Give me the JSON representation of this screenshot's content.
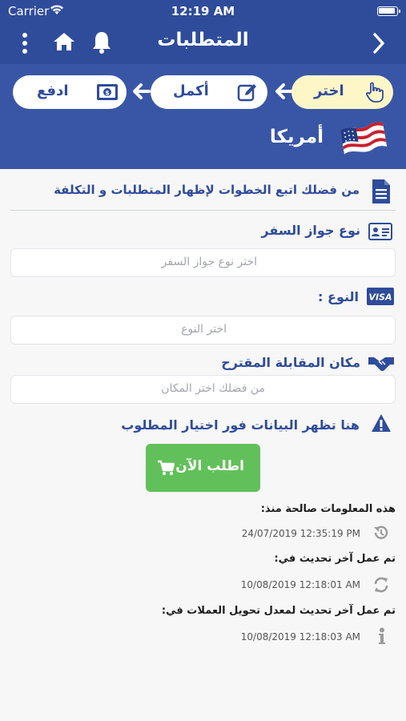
{
  "status": {
    "carrier": "Carrier",
    "time": "12:19 AM"
  },
  "nav": {
    "title": "المتطلبات"
  },
  "steps": [
    {
      "label": "اختر",
      "icon": "pointer-hand-icon",
      "active": true
    },
    {
      "label": "أكمل",
      "icon": "edit-pencil-icon",
      "active": false
    },
    {
      "label": "ادفع",
      "icon": "cash-icon",
      "active": false
    }
  ],
  "country": {
    "name": "أمريكا",
    "flag": "usa-flag-icon"
  },
  "info": "من فضلك اتبع الخطوات لإظهار المتطلبات و التكلفة",
  "fields": {
    "passport": {
      "label": "نوع جواز السفر",
      "placeholder": "اختر نوع جواز السفر"
    },
    "type": {
      "label": "النوع :",
      "placeholder": "اختر النوع"
    },
    "place": {
      "label": "مكان المقابلة المقترح",
      "placeholder": "من فضلك اختر المكان"
    }
  },
  "warning": "هنا تظهر البيانات فور اختيار المطلوب",
  "order_button": "اطلب الآن",
  "meta": {
    "valid_since_label": "هذه المعلومات صالحة منذ:",
    "valid_since_value": "24/07/2019 12:35:19 PM",
    "updated_label": "تم عمل آخر تحديث في:",
    "updated_value": "10/08/2019 12:18:01 AM",
    "currency_label": "تم عمل آخر تحديث لمعدل تحويل العملات في:",
    "currency_value": "10/08/2019 12:18:03 AM"
  },
  "colors": {
    "primary": "#2f4c9b",
    "header": "#3956a6",
    "active_step": "#fff6c7",
    "order": "#62c05a"
  }
}
